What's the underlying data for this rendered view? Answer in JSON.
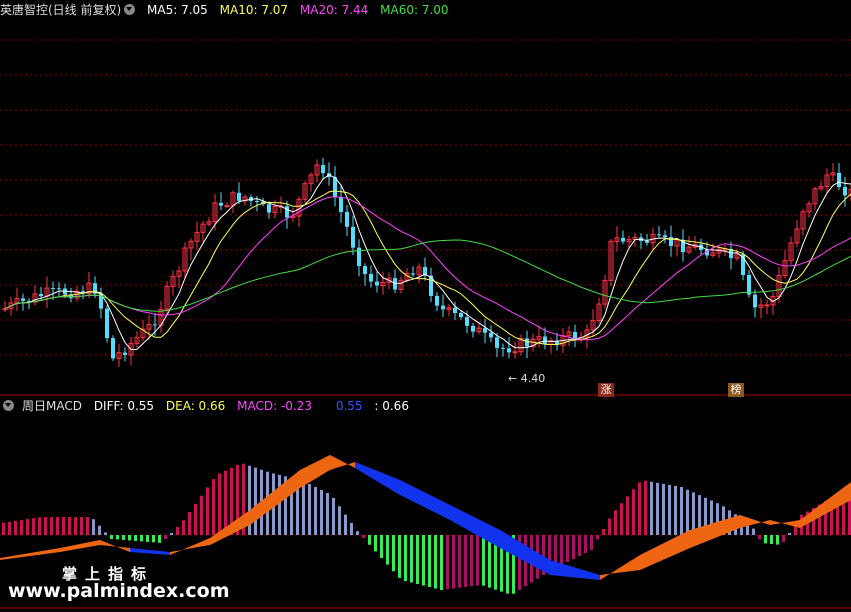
{
  "main_panel": {
    "title": "英唐智控(日线 前复权)",
    "ma5": {
      "label": "MA5: 7.05",
      "color": "#ffffff"
    },
    "ma10": {
      "label": "MA10: 7.07",
      "color": "#ffff55"
    },
    "ma20": {
      "label": "MA20: 7.44",
      "color": "#ff44ff"
    },
    "ma60": {
      "label": "MA60: 7.00",
      "color": "#44dd44"
    },
    "low_price_label": "4.40",
    "tags": [
      {
        "text": "涨",
        "color": "#8a2a1a"
      },
      {
        "text": "榜",
        "color": "#8a5a1a"
      }
    ]
  },
  "macd_panel": {
    "title": "周日MACD",
    "diff": {
      "label": "DIFF: 0.55",
      "color": "#ffffff"
    },
    "dea": {
      "label": "DEA: 0.66",
      "color": "#ffff55"
    },
    "macd": {
      "label": "MACD: -0.23",
      "color": "#ff44ff"
    },
    "extra1": {
      "label": "0.55",
      "color": "#3355ff"
    },
    "extra2": {
      "label": ": 0.66",
      "color": "#ffffff"
    }
  },
  "watermark": {
    "cn": "掌上指标",
    "url": "www.palmindex.com"
  },
  "colors": {
    "up": "#ff3344",
    "down": "#55ddff",
    "grid": "#8b0000",
    "hist_pos": "#cc1155",
    "hist_pos_fade": "#8899cc",
    "hist_neg": "#33ee55",
    "hist_neg_fade": "#aa1166",
    "band_up": "#ee6611",
    "band_down": "#1133ee"
  }
}
